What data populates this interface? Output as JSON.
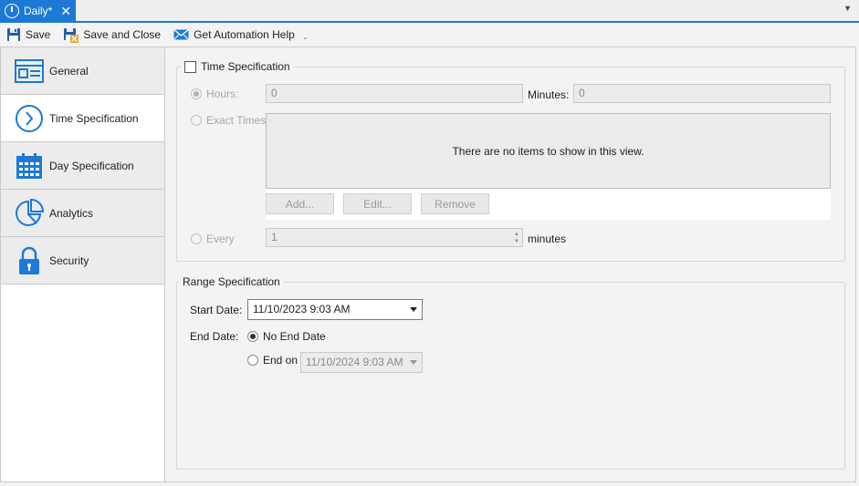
{
  "tab": {
    "title": "Daily*",
    "close": "✕",
    "menu": "▼"
  },
  "toolbar": {
    "save": "Save",
    "save_close": "Save and Close",
    "automation_help": "Get Automation Help",
    "dropdown": "⌄"
  },
  "nav": {
    "items": [
      {
        "label": "General",
        "icon": "general-icon"
      },
      {
        "label": "Time Specification",
        "icon": "clock-icon"
      },
      {
        "label": "Day Specification",
        "icon": "calendar-icon"
      },
      {
        "label": "Analytics",
        "icon": "pie-chart-icon"
      },
      {
        "label": "Security",
        "icon": "lock-icon"
      }
    ],
    "selected": "Time Specification"
  },
  "time_spec": {
    "legend": "Time Specification",
    "enabled": false,
    "hours_label": "Hours:",
    "hours_value": "0",
    "minutes_label": "Minutes:",
    "minutes_value": "0",
    "exact_times_label": "Exact Times",
    "empty_message": "There are no items to show in this view.",
    "add_label": "Add...",
    "edit_label": "Edit...",
    "remove_label": "Remove",
    "every_label": "Every",
    "every_value": "1",
    "every_unit": "minutes"
  },
  "range_spec": {
    "legend": "Range Specification",
    "start_label": "Start Date:",
    "start_value": "11/10/2023 9:03 AM",
    "end_label": "End Date:",
    "no_end_label": "No End Date",
    "end_on_label": "End on",
    "end_on_value": "11/10/2024 9:03 AM",
    "end_selection": "No End Date"
  },
  "colors": {
    "accent": "#1c7ad6"
  }
}
